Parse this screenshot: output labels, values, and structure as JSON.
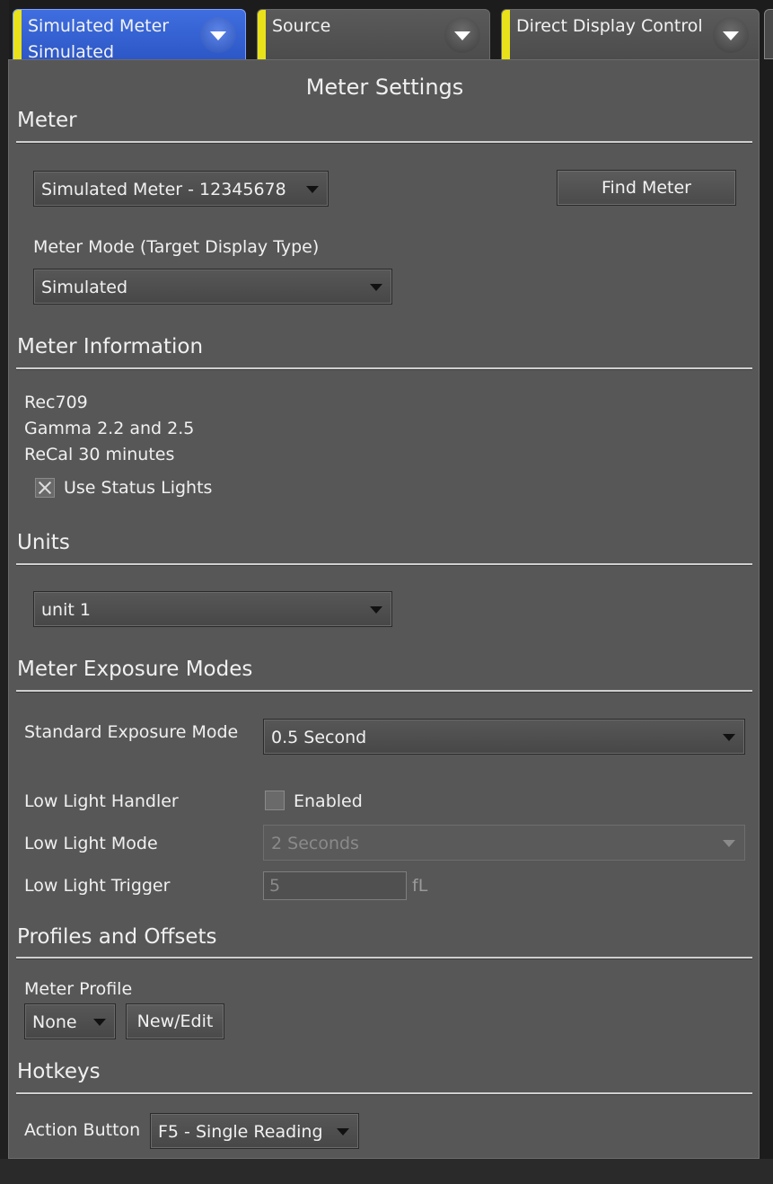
{
  "tabs": [
    {
      "line1": "Simulated Meter",
      "line2": "Simulated",
      "active": true
    },
    {
      "line1": "Source",
      "line2": "",
      "active": false
    },
    {
      "line1": "Direct Display Control",
      "line2": "",
      "active": false
    }
  ],
  "panel": {
    "title": "Meter Settings",
    "meter": {
      "section": "Meter",
      "device_select": "Simulated Meter - 12345678",
      "find_button": "Find Meter",
      "mode_label": "Meter Mode (Target Display Type)",
      "mode_select": "Simulated"
    },
    "info": {
      "section": "Meter Information",
      "lines": [
        "Rec709",
        "Gamma 2.2 and 2.5",
        "ReCal 30 minutes"
      ],
      "status_lights_label": "Use Status Lights",
      "status_lights_checked": true
    },
    "units": {
      "section": "Units",
      "select": "unit 1"
    },
    "exposure": {
      "section": "Meter Exposure Modes",
      "standard_label": "Standard Exposure Mode",
      "standard_select": "0.5 Second",
      "low_light_handler_label": "Low Light Handler",
      "enabled_label": "Enabled",
      "enabled_checked": false,
      "low_light_mode_label": "Low Light Mode",
      "low_light_mode_select": "2 Seconds",
      "low_light_trigger_label": "Low Light Trigger",
      "low_light_trigger_value": "5",
      "trigger_unit": "fL"
    },
    "profiles": {
      "section": "Profiles and Offsets",
      "meter_profile_label": "Meter Profile",
      "profile_select": "None",
      "new_edit_button": "New/Edit"
    },
    "hotkeys": {
      "section": "Hotkeys",
      "action_label": "Action Button",
      "action_select": "F5 - Single Reading"
    }
  }
}
